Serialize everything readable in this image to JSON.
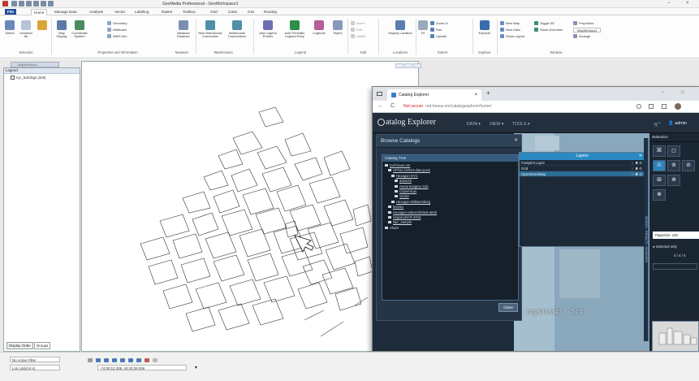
{
  "app": {
    "title": "GeoMedia Professional - GeoWorkspace1",
    "win_min": "−",
    "win_close": "×"
  },
  "ribbon": {
    "tabs": [
      {
        "label": "File"
      },
      {
        "label": "Home"
      },
      {
        "label": "Manage Data"
      },
      {
        "label": "Analysis"
      },
      {
        "label": "Vector"
      },
      {
        "label": "Labeling"
      },
      {
        "label": "Raster"
      },
      {
        "label": "Toolbox"
      },
      {
        "label": "Grid"
      },
      {
        "label": "Carto"
      },
      {
        "label": "GIS"
      },
      {
        "label": "Routing"
      }
    ],
    "selection": {
      "select": "Select",
      "unselect": "Unselect All",
      "group": "Selection"
    },
    "props": {
      "map_display": "Map Display",
      "coord_system": "Coordinate System",
      "geometry": "Geometry",
      "attributes": "Attributes",
      "wms_info": "WMS Info",
      "measure": "Measure Distance",
      "group": "Properties and Information"
    },
    "measure_group": "Measure",
    "warehouse": {
      "new_conn": "New Warehouse Connection",
      "connections": "Warehouse Connections",
      "group": "Warehouses"
    },
    "legend": {
      "add_entries": "Add Legend Entries",
      "add_thematic": "Add Thematic Legend Entry",
      "legends": "Legends",
      "styles": "Styles",
      "group": "Legend"
    },
    "edit": {
      "insert": "Insert",
      "edit": "Edit",
      "delete": "Delete",
      "group": "Edit"
    },
    "display_location": {
      "label": "Display Location",
      "group": "Locations"
    },
    "extent": {
      "fit": "Fit",
      "zoom": "Zoom In",
      "pan": "Pan",
      "update": "Update",
      "group": "Extent"
    },
    "explorer": {
      "label": "Explorer",
      "group": "Explorer"
    },
    "window": {
      "new_map": "New Map",
      "new_data": "New Data",
      "show_layout": "Show Layout",
      "toggle3d": "Toggle 3D",
      "show_overview": "Show Overview",
      "properties": "Properties",
      "map_window": "MapWindow1",
      "arrange": "Arrange",
      "group": "Window"
    }
  },
  "doc": {
    "tab": "MapWindow1"
  },
  "legend_panel": {
    "header": "Legend",
    "row": "nyc_buildings (326)",
    "tabs": [
      "Display Order",
      "Groups"
    ]
  },
  "browser": {
    "tab_title": "Catalog Explorer",
    "tab_close": "×",
    "new_tab": "+",
    "not_secure": "Not secure",
    "url_host": "md-hexus-vm",
    "url_path": "/catalogexplorer/home/",
    "nav_back": "←",
    "nav_reload": "C",
    "win_ctl": "−",
    "win_max": "□"
  },
  "catalog": {
    "brand": "atalog Explorer",
    "menu": [
      {
        "label": "DATA ▾"
      },
      {
        "label": "VIEW ▾"
      },
      {
        "label": "TOOLS ▾"
      }
    ],
    "user": "admin",
    "cart": "1",
    "panel_title": "Browse Catalogs",
    "tree_header": "Catalog Tree",
    "tree": [
      {
        "label": "md-hexus-vm",
        "indent": 0
      },
      {
        "label": "APOLLO2023-data-pack",
        "indent": 1
      },
      {
        "label": "Hexagon NYC",
        "indent": 2
      },
      {
        "label": "3dmesh",
        "indent": 3
      },
      {
        "label": "Aerial Imagery Sub",
        "indent": 3
      },
      {
        "label": "Copernicus",
        "indent": 3
      },
      {
        "label": "Vector",
        "indent": 3
      },
      {
        "label": "Hexagon-Williamsburg",
        "indent": 2
      },
      {
        "label": "levels1",
        "indent": 1
      },
      {
        "label": "Hexagon-orbext-limited-atmb",
        "indent": 1
      },
      {
        "label": "VegasLiDAR-2018",
        "indent": 1
      },
      {
        "label": "Nyc_sample",
        "indent": 1
      },
      {
        "label": "Share",
        "indent": 0
      }
    ],
    "close": "Close",
    "layers_title": "Layers",
    "layers": [
      {
        "name": "Footprint Layer",
        "selected": false
      },
      {
        "name": "Grid",
        "selected": false
      },
      {
        "name": "OpenStreetMap",
        "selected": true
      }
    ],
    "layer_ctl": "⋮ ✖ ⊙",
    "overlay_text": "rcgsncsscr",
    "overlay_text2": "Sco",
    "vertical_tabs": "SEARCH · RESULTS · ADVANCED",
    "selection_title": "Selection",
    "sel_buttons": [
      "⌘",
      "◻",
      "⊙",
      "⊚",
      "⊘",
      "⊞",
      "⊕",
      "⊗"
    ],
    "page_size": "PageSize: 100",
    "selected_only": "Selected only",
    "count": "4 / 4 / 4"
  },
  "status": {
    "active_filter": "No Active Filter",
    "coord_label": "Lon Lat(d:m:s)",
    "coord_value": "-74:00:12.306, 40:42:26.036"
  }
}
